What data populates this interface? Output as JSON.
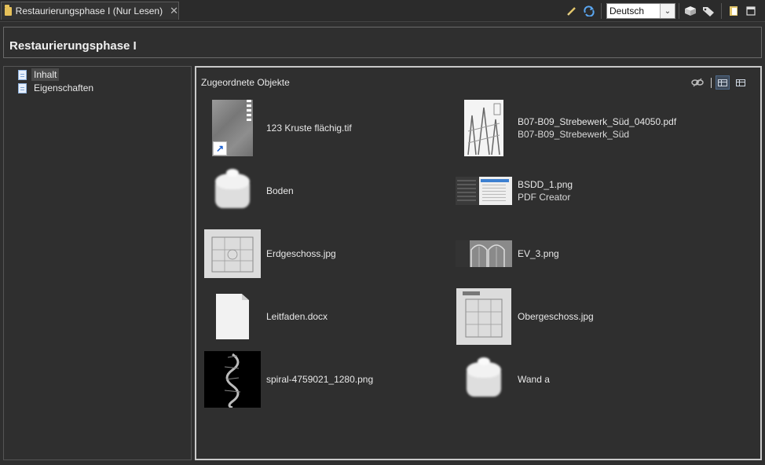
{
  "editor_tab": {
    "title": "Restaurierungsphase I (Nur Lesen)",
    "close_glyph": "✕"
  },
  "toolbar": {
    "language_value": "Deutsch",
    "icons": [
      "pencil-icon",
      "sync-arrows-icon",
      "cube-icon",
      "tag-icon",
      "clipboard-icon",
      "maximize-icon"
    ]
  },
  "page": {
    "title": "Restaurierungsphase I"
  },
  "tree": {
    "items": [
      {
        "label": "Inhalt",
        "selected": true
      },
      {
        "label": "Eigenschaften",
        "selected": false
      }
    ]
  },
  "content": {
    "section_title": "Zugeordnete Objekte",
    "view_separator": "|",
    "objects": [
      {
        "name": "123 Kruste flächig.tif",
        "subtitle": "",
        "thumb": "gray-texture",
        "shortcut": true
      },
      {
        "name": "B07-B09_Strebewerk_Süd_04050.pdf",
        "subtitle": "B07-B09_Strebewerk_Süd",
        "thumb": "drawing"
      },
      {
        "name": "Boden",
        "subtitle": "",
        "thumb": "cube"
      },
      {
        "name": "BSDD_1.png",
        "subtitle": "PDF Creator",
        "thumb": "screenshot"
      },
      {
        "name": "Erdgeschoss.jpg",
        "subtitle": "",
        "thumb": "floorplan"
      },
      {
        "name": "EV_3.png",
        "subtitle": "",
        "thumb": "vault"
      },
      {
        "name": "Leitfaden.docx",
        "subtitle": "",
        "thumb": "document"
      },
      {
        "name": "Obergeschoss.jpg",
        "subtitle": "",
        "thumb": "floorplan"
      },
      {
        "name": "spiral-4759021_1280.png",
        "subtitle": "",
        "thumb": "spiral"
      },
      {
        "name": "Wand a",
        "subtitle": "",
        "thumb": "cube"
      }
    ]
  },
  "colors": {
    "background": "#2f2f2f",
    "panel_border_active": "#c9c9c9",
    "text": "#e8e8e8"
  }
}
